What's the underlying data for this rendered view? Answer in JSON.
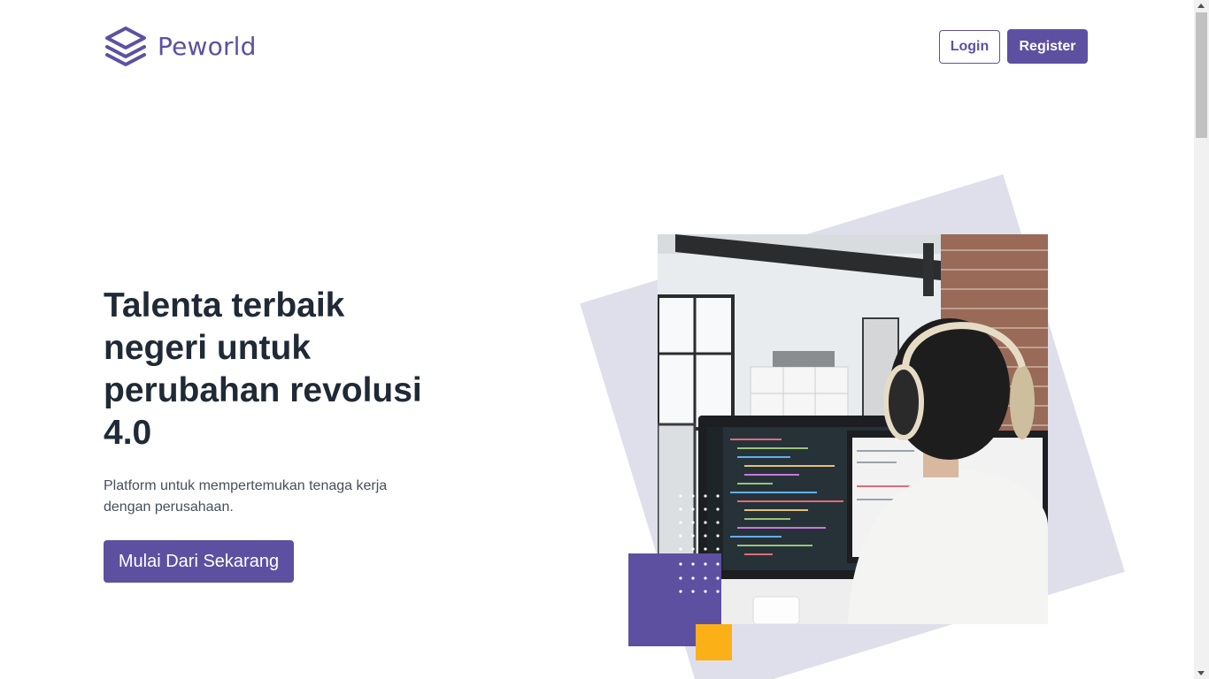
{
  "brand": {
    "name": "Peworld",
    "icon": "layers-icon",
    "color": "#5e50a1"
  },
  "nav": {
    "login_label": "Login",
    "register_label": "Register"
  },
  "hero": {
    "title": "Talenta terbaik negeri untuk perubahan revolusi 4.0",
    "subtitle": "Platform untuk mempertemukan tenaga kerja dengan perusahaan.",
    "cta_label": "Mulai Dari Sekarang",
    "image": "developer-wearing-headphones-coding-photo"
  },
  "colors": {
    "primary": "#5e50a1",
    "accent_yellow": "#fbb017",
    "backdrop": "#dfdfec",
    "heading": "#1f2a36"
  }
}
